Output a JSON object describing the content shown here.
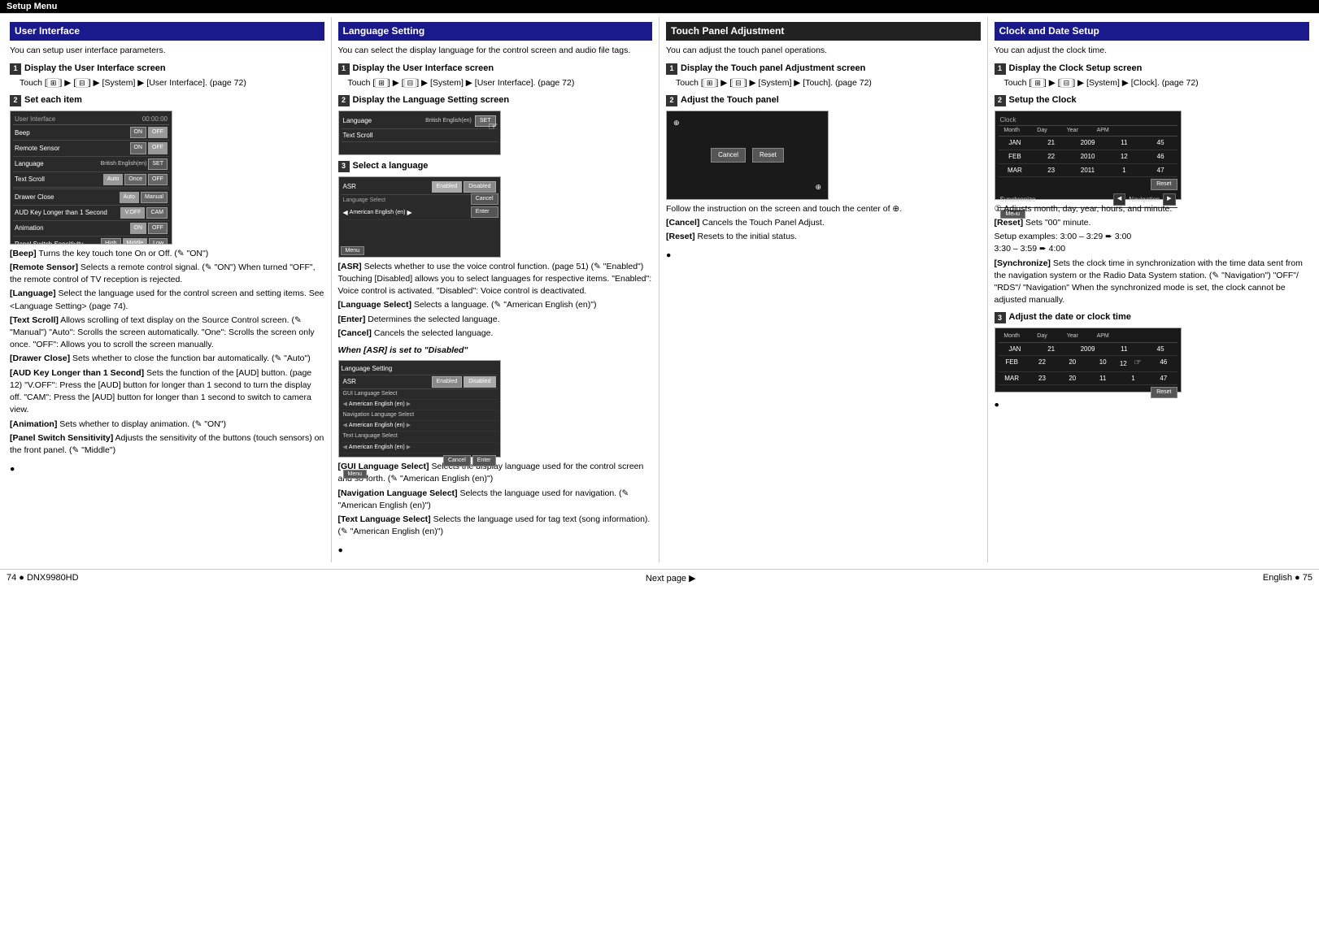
{
  "topBar": {
    "title": "Setup Menu"
  },
  "sections": [
    {
      "id": "user-interface",
      "title": "User Interface",
      "titleHighlight": "blue",
      "intro": "You can setup user interface parameters.",
      "steps": [
        {
          "num": "1",
          "label": "Display the User Interface screen",
          "body": "Touch [  ] ▶ [  ] ▶ [System] ▶ [User Interface]. (page 72)"
        },
        {
          "num": "2",
          "label": "Set each item"
        }
      ],
      "items": [
        {
          "term": "[Beep]",
          "desc": "Turns the key touch tone On or Off. (✎ \"ON\")"
        },
        {
          "term": "[Remote Sensor]",
          "desc": "Selects a remote control signal. (✎ \"ON\") When turned \"OFF\", the remote control of TV reception is rejected."
        },
        {
          "term": "[Language]",
          "desc": "Select the language used for the control screen and setting items. See <Language Setting> (page 74)."
        },
        {
          "term": "[Text Scroll]",
          "desc": "Allows scrolling of text display on the Source Control screen. (✎ \"Manual\") \"Auto\": Scrolls the screen automatically. \"One\": Scrolls the screen only once. \"OFF\": Allows you to scroll the screen manually."
        },
        {
          "term": "[Drawer Close]",
          "desc": "Sets whether to close the function bar automatically. (✎ \"Auto\")"
        },
        {
          "term": "[AUD Key Longer than 1 Second]",
          "desc": "Sets the function of the [AUD] button. (page 12) \"V.OFF\": Press the [AUD] button for longer than 1 second to turn the display off. \"CAM\": Press the [AUD] button for longer than 1 second to switch to camera view."
        },
        {
          "term": "[Animation]",
          "desc": "Sets whether to display animation. (✎ \"ON\")"
        },
        {
          "term": "[Panel Switch Sensitivity]",
          "desc": "Adjusts the sensitivity of the buttons (touch sensors) on the front panel. (✎ \"Middle\")"
        }
      ]
    },
    {
      "id": "language-setting",
      "title": "Language Setting",
      "titleHighlight": "blue",
      "intro": "You can select the display language for the control screen and audio file tags.",
      "steps": [
        {
          "num": "1",
          "label": "Display the User Interface screen",
          "body": "Touch [  ] ▶ [  ] ▶ [System] ▶ [User Interface]. (page 72)"
        },
        {
          "num": "2",
          "label": "Display the Language Setting screen"
        },
        {
          "num": "3",
          "label": "Select a language"
        }
      ],
      "items": [
        {
          "term": "[ASR]",
          "desc": "Selects whether to use the voice control function. (page 51) (✎ \"Enabled\") Touching [Disabled] allows you to select languages for respective items. \"Enabled\": Voice control is activated. \"Disabled\": Voice control is deactivated."
        },
        {
          "term": "[Language Select]",
          "desc": "Selects a language. (✎ \"American English (en)\")"
        },
        {
          "term": "[Enter]",
          "desc": "Determines the selected language."
        },
        {
          "term": "[Cancel]",
          "desc": "Cancels the selected language."
        }
      ],
      "whenDisabled": {
        "title": "When [ASR] is set to \"Disabled\"",
        "items": [
          {
            "term": "[GUI Language Select]",
            "desc": "Selects the display language used for the control screen and so forth. (✎ \"American English (en)\")"
          },
          {
            "term": "[Navigation Language Select]",
            "desc": "Selects the language used for navigation. (✎ \"American English (en)\")"
          },
          {
            "term": "[Text Language Select]",
            "desc": "Selects the language used for tag text (song information). (✎ \"American English (en)\")"
          }
        ]
      }
    },
    {
      "id": "touch-panel",
      "title": "Touch Panel Adjustment",
      "titleHighlight": "highlighted",
      "intro": "You can adjust the touch panel operations.",
      "steps": [
        {
          "num": "1",
          "label": "Display the Touch panel Adjustment screen",
          "body": "Touch [  ] ▶ [  ] ▶ [System] ▶ [Touch]. (page 72)"
        },
        {
          "num": "2",
          "label": "Adjust the Touch panel"
        }
      ],
      "touchNote": "Follow the instruction on the screen and touch the center of ⊕.",
      "touchItems": [
        {
          "term": "[Cancel]",
          "desc": "Cancels the Touch Panel Adjust."
        },
        {
          "term": "[Reset]",
          "desc": "Resets to the initial status."
        }
      ]
    },
    {
      "id": "clock-date",
      "title": "Clock and Date Setup",
      "titleHighlight": "blue",
      "intro": "You can adjust the clock time.",
      "steps": [
        {
          "num": "1",
          "label": "Display the Clock Setup screen",
          "body": "Touch [  ] ▶ [  ] ▶ [System] ▶ [Clock]. (page 72)"
        },
        {
          "num": "2",
          "label": "Setup the Clock"
        },
        {
          "num": "3",
          "label": "Adjust the date or clock time"
        }
      ],
      "clockNote1": "Adjusts month, day, year, hours, and minute.",
      "clockReset": {
        "term": "[Reset]",
        "desc": "Sets \"00\" minute."
      },
      "clockExamples": "Setup examples: 3:00 – 3:29 ➨ 3:00\n                        3:30 – 3:59 ➨ 4:00",
      "clockSync": {
        "term": "[Synchronize]",
        "desc": "Sets the clock time in synchronization with the time data sent from the navigation system or the Radio Data System station. (✎ \"Navigation\") \"OFF\"/ \"RDS\"/ \"Navigation\" When the synchronized mode is set, the clock cannot be adjusted manually."
      },
      "clockTable": {
        "headers": [
          "Month",
          "Day",
          "Year",
          "APM",
          "",
          ""
        ],
        "rows": [
          [
            "JAN",
            "21",
            "2009",
            "11",
            "45"
          ],
          [
            "FEB",
            "22",
            "2010",
            "12",
            "46"
          ],
          [
            "MAR",
            "23",
            "2011",
            "1",
            "47"
          ]
        ]
      }
    }
  ],
  "footer": {
    "leftText": "74   ● DNX9980HD",
    "rightText": "English   ●   75",
    "nextPage": "Next page ▶"
  }
}
